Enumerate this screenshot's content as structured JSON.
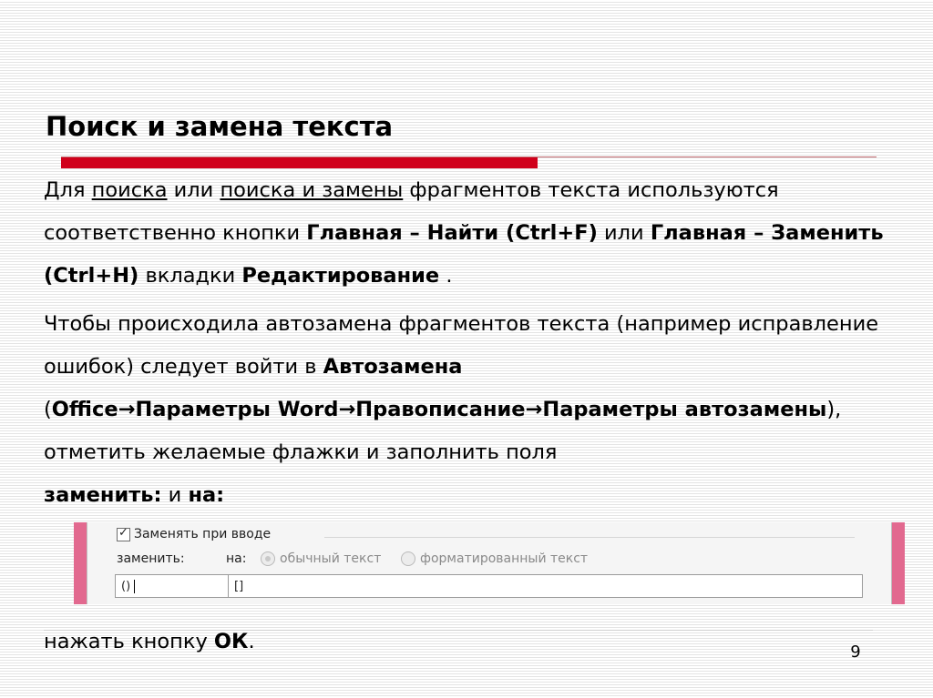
{
  "slide": {
    "title": "Поиск и замена текста",
    "page_number": "9"
  },
  "paragraph1": {
    "t1": "Для ",
    "u1": "поиска",
    "t2": " или ",
    "u2": "поиска и замены",
    "t3": " фрагментов текста используются соответственно кнопки ",
    "b1": "Главная – Найти (Ctrl+F)",
    "t4": " или ",
    "b2": "Главная – Заменить  (Ctrl+H)",
    "t5": " вкладки ",
    "b3": "Редактирование",
    "t6": " ."
  },
  "paragraph2": {
    "t1": "Чтобы происходила автозамена фрагментов текста (например исправление ошибок) следует войти в ",
    "b1": "Автозамена",
    "t2": " (",
    "b2": "Office",
    "b3": "Параметры Word",
    "b4": "Правописание",
    "b5": "Параметры автозамены",
    "t3": "), отметить желаемые флажки и заполнить поля ",
    "b6": "заменить:",
    "t4": "   и  ",
    "b7": "на:"
  },
  "paragraph3": {
    "t1": "нажать кнопку ",
    "b1": "ОК",
    "t2": "."
  },
  "arrow_symbol": "→",
  "dialog": {
    "checkbox_label": "Заменять при вводе",
    "checkbox_checked": true,
    "replace_label": "заменить:",
    "with_label": "на:",
    "option_plain": "обычный текст",
    "option_formatted": "форматированный текст",
    "replace_value": "()",
    "with_value": "[]"
  },
  "colors": {
    "accent_red": "#d0001b",
    "dialog_stripe": "#e2698f"
  }
}
